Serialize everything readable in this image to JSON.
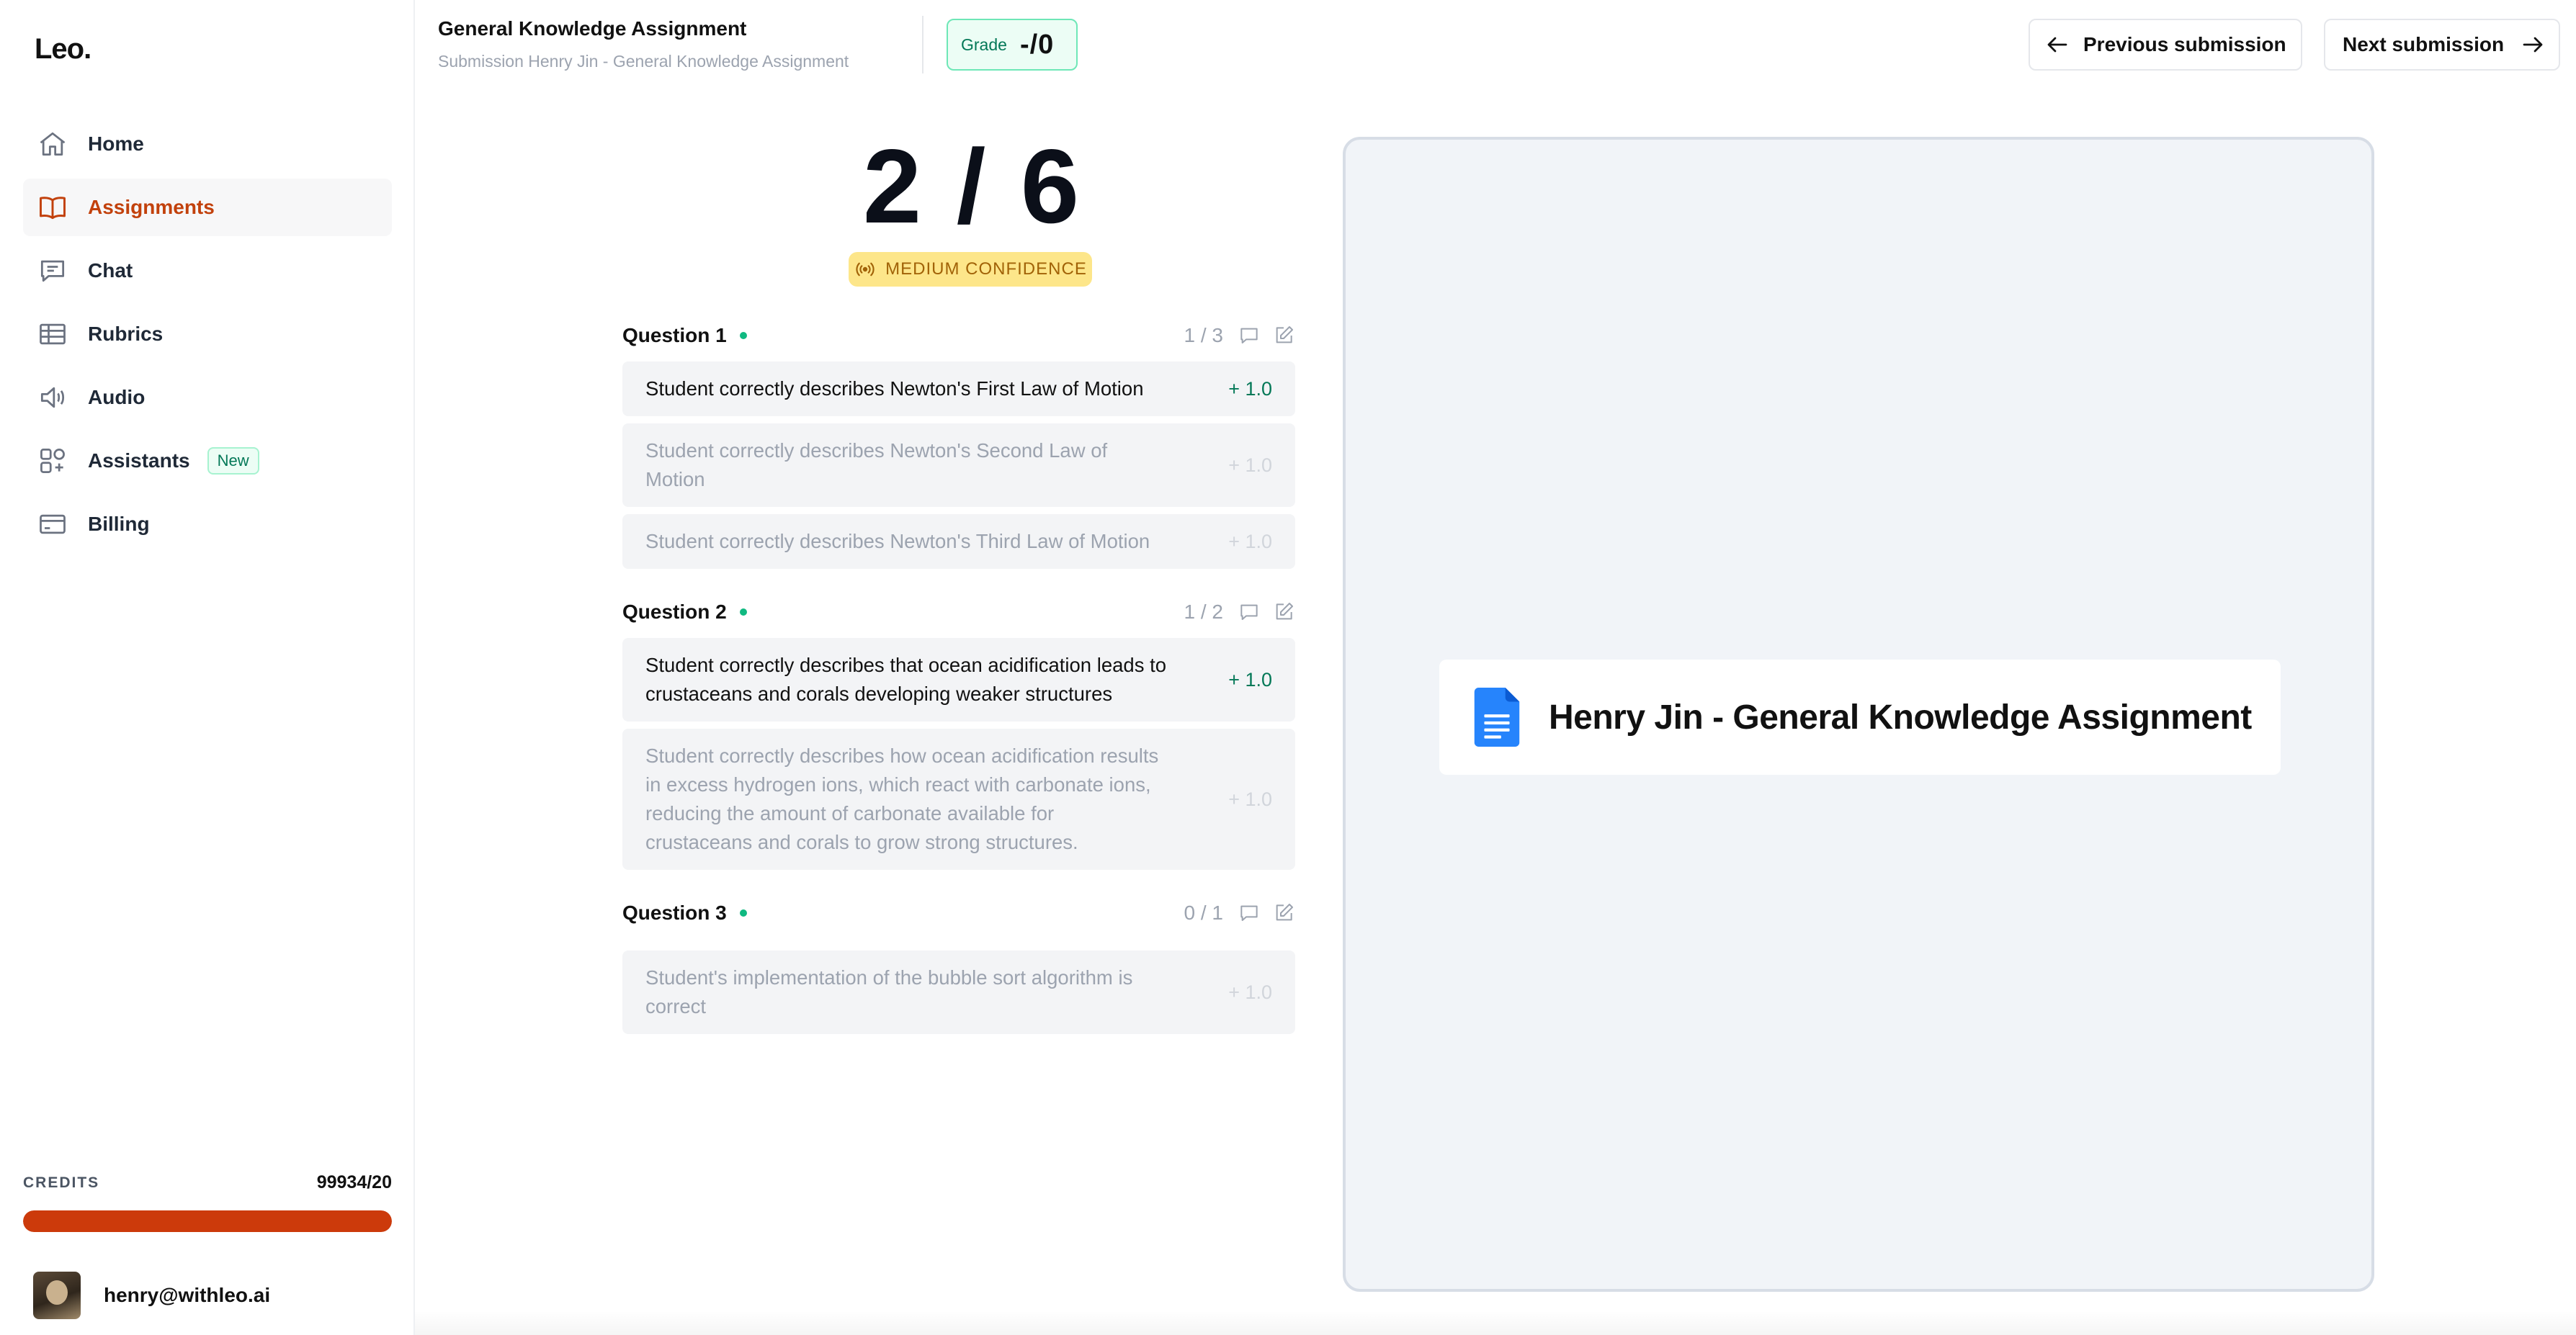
{
  "app": {
    "logo": "Leo."
  },
  "sidebar": {
    "items": [
      {
        "label": "Home",
        "icon": "home-icon",
        "active": false
      },
      {
        "label": "Assignments",
        "icon": "book-icon",
        "active": true
      },
      {
        "label": "Chat",
        "icon": "chat-icon",
        "active": false
      },
      {
        "label": "Rubrics",
        "icon": "table-icon",
        "active": false
      },
      {
        "label": "Audio",
        "icon": "speaker-icon",
        "active": false
      },
      {
        "label": "Assistants",
        "icon": "assistants-icon",
        "active": false,
        "badge": "New"
      },
      {
        "label": "Billing",
        "icon": "credit-card-icon",
        "active": false
      }
    ],
    "credits": {
      "label": "CREDITS",
      "value": "99934/20",
      "fill_fraction": 1.0
    },
    "user": {
      "email": "henry@withleo.ai"
    }
  },
  "header": {
    "title": "General Knowledge Assignment",
    "subtitle": "Submission Henry Jin - General Knowledge Assignment",
    "grade_label": "Grade",
    "grade_value": "-/0",
    "prev_label": "Previous submission",
    "next_label": "Next submission"
  },
  "score": {
    "value": "2 / 6",
    "confidence": "MEDIUM CONFIDENCE"
  },
  "questions": [
    {
      "title": "Question 1",
      "score": "1 / 3",
      "criteria": [
        {
          "text": "Student correctly describes Newton's First Law of Motion",
          "points": "+ 1.0",
          "met": true
        },
        {
          "text": "Student correctly describes Newton's Second Law of Motion",
          "points": "+ 1.0",
          "met": false
        },
        {
          "text": "Student correctly describes Newton's Third Law of Motion",
          "points": "+ 1.0",
          "met": false
        }
      ]
    },
    {
      "title": "Question 2",
      "score": "1 / 2",
      "criteria": [
        {
          "text": "Student correctly describes that ocean acidification leads to crustaceans and corals developing weaker structures",
          "points": "+ 1.0",
          "met": true
        },
        {
          "text": "Student correctly describes how ocean acidification results in excess hydrogen ions, which react with carbonate ions, reducing the amount of carbonate available for crustaceans and corals to grow strong structures.",
          "points": "+ 1.0",
          "met": false
        }
      ]
    },
    {
      "title": "Question 3",
      "score": "0 / 1",
      "criteria": [
        {
          "text": "Student's implementation of the bubble sort algorithm is correct",
          "points": "+ 1.0",
          "met": false
        }
      ]
    }
  ],
  "preview": {
    "doc_name": "Henry Jin - General Knowledge Assignment",
    "icon": "google-docs-icon"
  },
  "colors": {
    "accent": "#c2410c",
    "credits_bar": "#cc3a0b",
    "success": "#047857",
    "confidence_bg": "#fde68a"
  }
}
